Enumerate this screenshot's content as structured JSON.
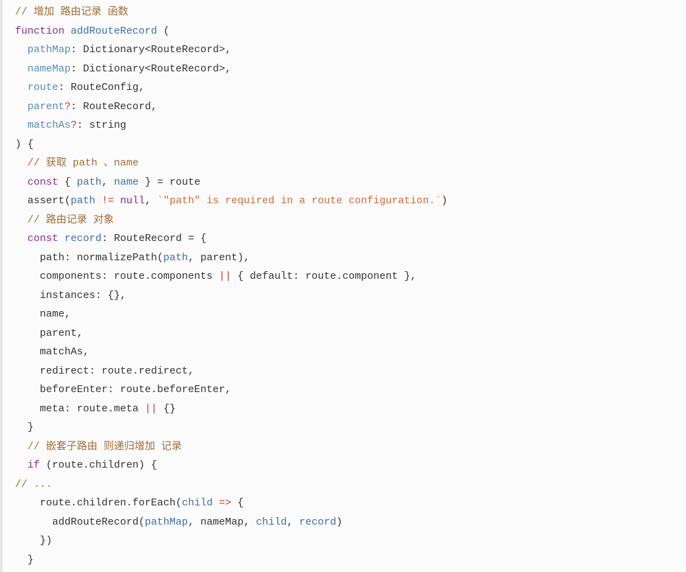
{
  "code": {
    "lines": [
      {
        "indent": 0,
        "tokens": [
          {
            "cls": "c-comment",
            "text": "// 增加 路由记录 函数"
          }
        ]
      },
      {
        "indent": 0,
        "tokens": [
          {
            "cls": "c-keyword",
            "text": "function"
          },
          {
            "cls": "c-plain",
            "text": " "
          },
          {
            "cls": "c-funcname",
            "text": "addRouteRecord"
          },
          {
            "cls": "c-plain",
            "text": " ("
          }
        ]
      },
      {
        "indent": 1,
        "tokens": [
          {
            "cls": "c-param",
            "text": "pathMap"
          },
          {
            "cls": "c-plain",
            "text": ": Dictionary<RouteRecord>,"
          }
        ]
      },
      {
        "indent": 1,
        "tokens": [
          {
            "cls": "c-param",
            "text": "nameMap"
          },
          {
            "cls": "c-plain",
            "text": ": Dictionary<RouteRecord>,"
          }
        ]
      },
      {
        "indent": 1,
        "tokens": [
          {
            "cls": "c-param",
            "text": "route"
          },
          {
            "cls": "c-plain",
            "text": ": RouteConfig,"
          }
        ]
      },
      {
        "indent": 1,
        "tokens": [
          {
            "cls": "c-param",
            "text": "parent"
          },
          {
            "cls": "c-operator",
            "text": "?"
          },
          {
            "cls": "c-plain",
            "text": ": RouteRecord,"
          }
        ]
      },
      {
        "indent": 1,
        "tokens": [
          {
            "cls": "c-param",
            "text": "matchAs"
          },
          {
            "cls": "c-operator",
            "text": "?"
          },
          {
            "cls": "c-plain",
            "text": ": string"
          }
        ]
      },
      {
        "indent": 0,
        "tokens": [
          {
            "cls": "c-plain",
            "text": ") {"
          }
        ]
      },
      {
        "indent": 1,
        "tokens": [
          {
            "cls": "c-comment",
            "text": "// 获取 path 、name"
          }
        ]
      },
      {
        "indent": 1,
        "tokens": [
          {
            "cls": "c-keyword",
            "text": "const"
          },
          {
            "cls": "c-plain",
            "text": " { "
          },
          {
            "cls": "c-var",
            "text": "path"
          },
          {
            "cls": "c-plain",
            "text": ", "
          },
          {
            "cls": "c-var",
            "text": "name"
          },
          {
            "cls": "c-plain",
            "text": " } = route"
          }
        ]
      },
      {
        "indent": 1,
        "tokens": [
          {
            "cls": "c-plain",
            "text": "assert("
          },
          {
            "cls": "c-var",
            "text": "path"
          },
          {
            "cls": "c-plain",
            "text": " "
          },
          {
            "cls": "c-operator",
            "text": "!="
          },
          {
            "cls": "c-plain",
            "text": " "
          },
          {
            "cls": "c-keyword",
            "text": "null"
          },
          {
            "cls": "c-plain",
            "text": ", "
          },
          {
            "cls": "c-string",
            "text": "`\"path\" is required in a route configuration.`"
          },
          {
            "cls": "c-plain",
            "text": ")"
          }
        ]
      },
      {
        "indent": 1,
        "tokens": [
          {
            "cls": "c-comment",
            "text": "// 路由记录 对象"
          }
        ]
      },
      {
        "indent": 1,
        "tokens": [
          {
            "cls": "c-keyword",
            "text": "const"
          },
          {
            "cls": "c-plain",
            "text": " "
          },
          {
            "cls": "c-var",
            "text": "record"
          },
          {
            "cls": "c-plain",
            "text": ": RouteRecord = {"
          }
        ]
      },
      {
        "indent": 2,
        "tokens": [
          {
            "cls": "c-plain",
            "text": "path: normalizePath("
          },
          {
            "cls": "c-var",
            "text": "path"
          },
          {
            "cls": "c-plain",
            "text": ", parent),"
          }
        ]
      },
      {
        "indent": 2,
        "tokens": [
          {
            "cls": "c-plain",
            "text": "components: route.components "
          },
          {
            "cls": "c-operator",
            "text": "||"
          },
          {
            "cls": "c-plain",
            "text": " { default: route.component },"
          }
        ]
      },
      {
        "indent": 2,
        "tokens": [
          {
            "cls": "c-plain",
            "text": "instances: {},"
          }
        ]
      },
      {
        "indent": 2,
        "tokens": [
          {
            "cls": "c-plain",
            "text": "name,"
          }
        ]
      },
      {
        "indent": 2,
        "tokens": [
          {
            "cls": "c-plain",
            "text": "parent,"
          }
        ]
      },
      {
        "indent": 2,
        "tokens": [
          {
            "cls": "c-plain",
            "text": "matchAs,"
          }
        ]
      },
      {
        "indent": 2,
        "tokens": [
          {
            "cls": "c-plain",
            "text": "redirect: route.redirect,"
          }
        ]
      },
      {
        "indent": 2,
        "tokens": [
          {
            "cls": "c-plain",
            "text": "beforeEnter: route.beforeEnter,"
          }
        ]
      },
      {
        "indent": 2,
        "tokens": [
          {
            "cls": "c-plain",
            "text": "meta: route.meta "
          },
          {
            "cls": "c-operator",
            "text": "||"
          },
          {
            "cls": "c-plain",
            "text": " {}"
          }
        ]
      },
      {
        "indent": 1,
        "tokens": [
          {
            "cls": "c-plain",
            "text": "}"
          }
        ]
      },
      {
        "indent": 1,
        "tokens": [
          {
            "cls": "c-comment",
            "text": "// 嵌套子路由 则递归增加 记录"
          }
        ]
      },
      {
        "indent": 1,
        "tokens": [
          {
            "cls": "c-keyword",
            "text": "if"
          },
          {
            "cls": "c-plain",
            "text": " (route.children) {"
          }
        ]
      },
      {
        "indent": 0,
        "tokens": [
          {
            "cls": "c-comment",
            "text": "// ..."
          }
        ]
      },
      {
        "indent": 2,
        "tokens": [
          {
            "cls": "c-plain",
            "text": "route.children.forEach("
          },
          {
            "cls": "c-var",
            "text": "child"
          },
          {
            "cls": "c-plain",
            "text": " "
          },
          {
            "cls": "c-operator",
            "text": "=>"
          },
          {
            "cls": "c-plain",
            "text": " {"
          }
        ]
      },
      {
        "indent": 3,
        "tokens": [
          {
            "cls": "c-plain",
            "text": "addRouteRecord("
          },
          {
            "cls": "c-var",
            "text": "pathMap"
          },
          {
            "cls": "c-plain",
            "text": ", nameMap, "
          },
          {
            "cls": "c-var",
            "text": "child"
          },
          {
            "cls": "c-plain",
            "text": ", "
          },
          {
            "cls": "c-var",
            "text": "record"
          },
          {
            "cls": "c-plain",
            "text": ")"
          }
        ]
      },
      {
        "indent": 2,
        "tokens": [
          {
            "cls": "c-plain",
            "text": "})"
          }
        ]
      },
      {
        "indent": 1,
        "tokens": [
          {
            "cls": "c-plain",
            "text": "}"
          }
        ]
      }
    ]
  }
}
